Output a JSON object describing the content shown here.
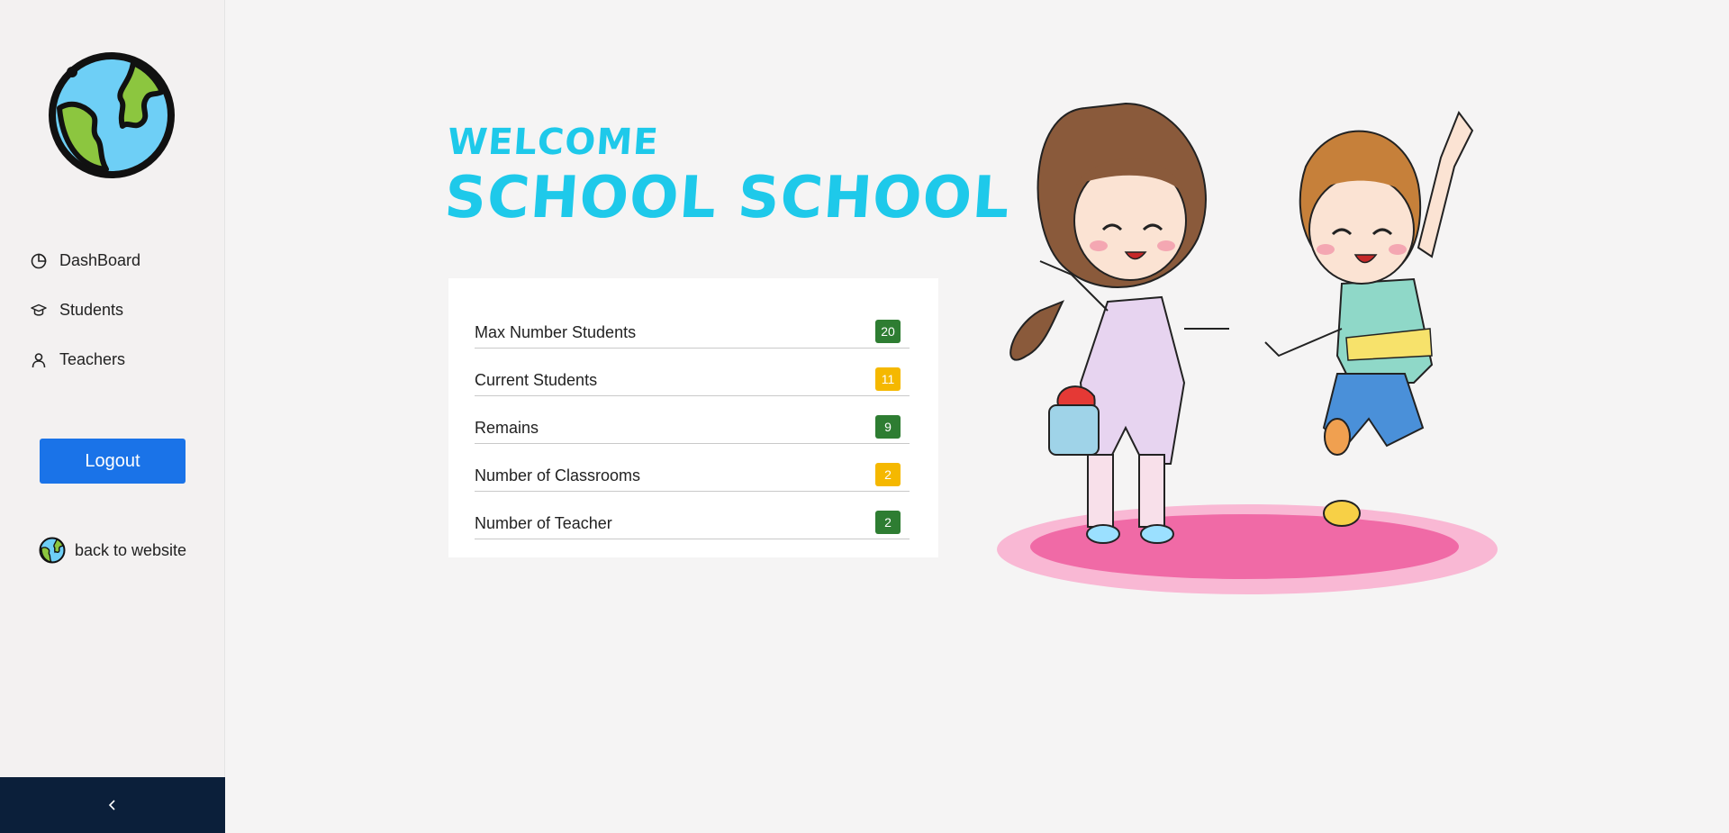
{
  "sidebar": {
    "nav": [
      {
        "label": "DashBoard",
        "icon": "pie-chart-icon"
      },
      {
        "label": "Students",
        "icon": "graduation-cap-icon"
      },
      {
        "label": "Teachers",
        "icon": "person-icon"
      }
    ],
    "logout_label": "Logout",
    "back_label": "back to website",
    "collapse_icon": "chevron-left-icon"
  },
  "hero": {
    "welcome": "WELCOME",
    "school_name": "SCHOOL SCHOOL"
  },
  "stats": [
    {
      "label": "Max Number Students",
      "value": "20",
      "color": "#2e7d32"
    },
    {
      "label": "Current Students",
      "value": "11",
      "color": "#f5b800"
    },
    {
      "label": "Remains",
      "value": "9",
      "color": "#2e7d32"
    },
    {
      "label": "Number of Classrooms",
      "value": "2",
      "color": "#f5b800"
    },
    {
      "label": "Number of Teacher",
      "value": "2",
      "color": "#2e7d32"
    }
  ],
  "colors": {
    "accent": "#1ec9ea",
    "logout": "#1a73e8",
    "collapse_bar": "#0b1f3a"
  }
}
